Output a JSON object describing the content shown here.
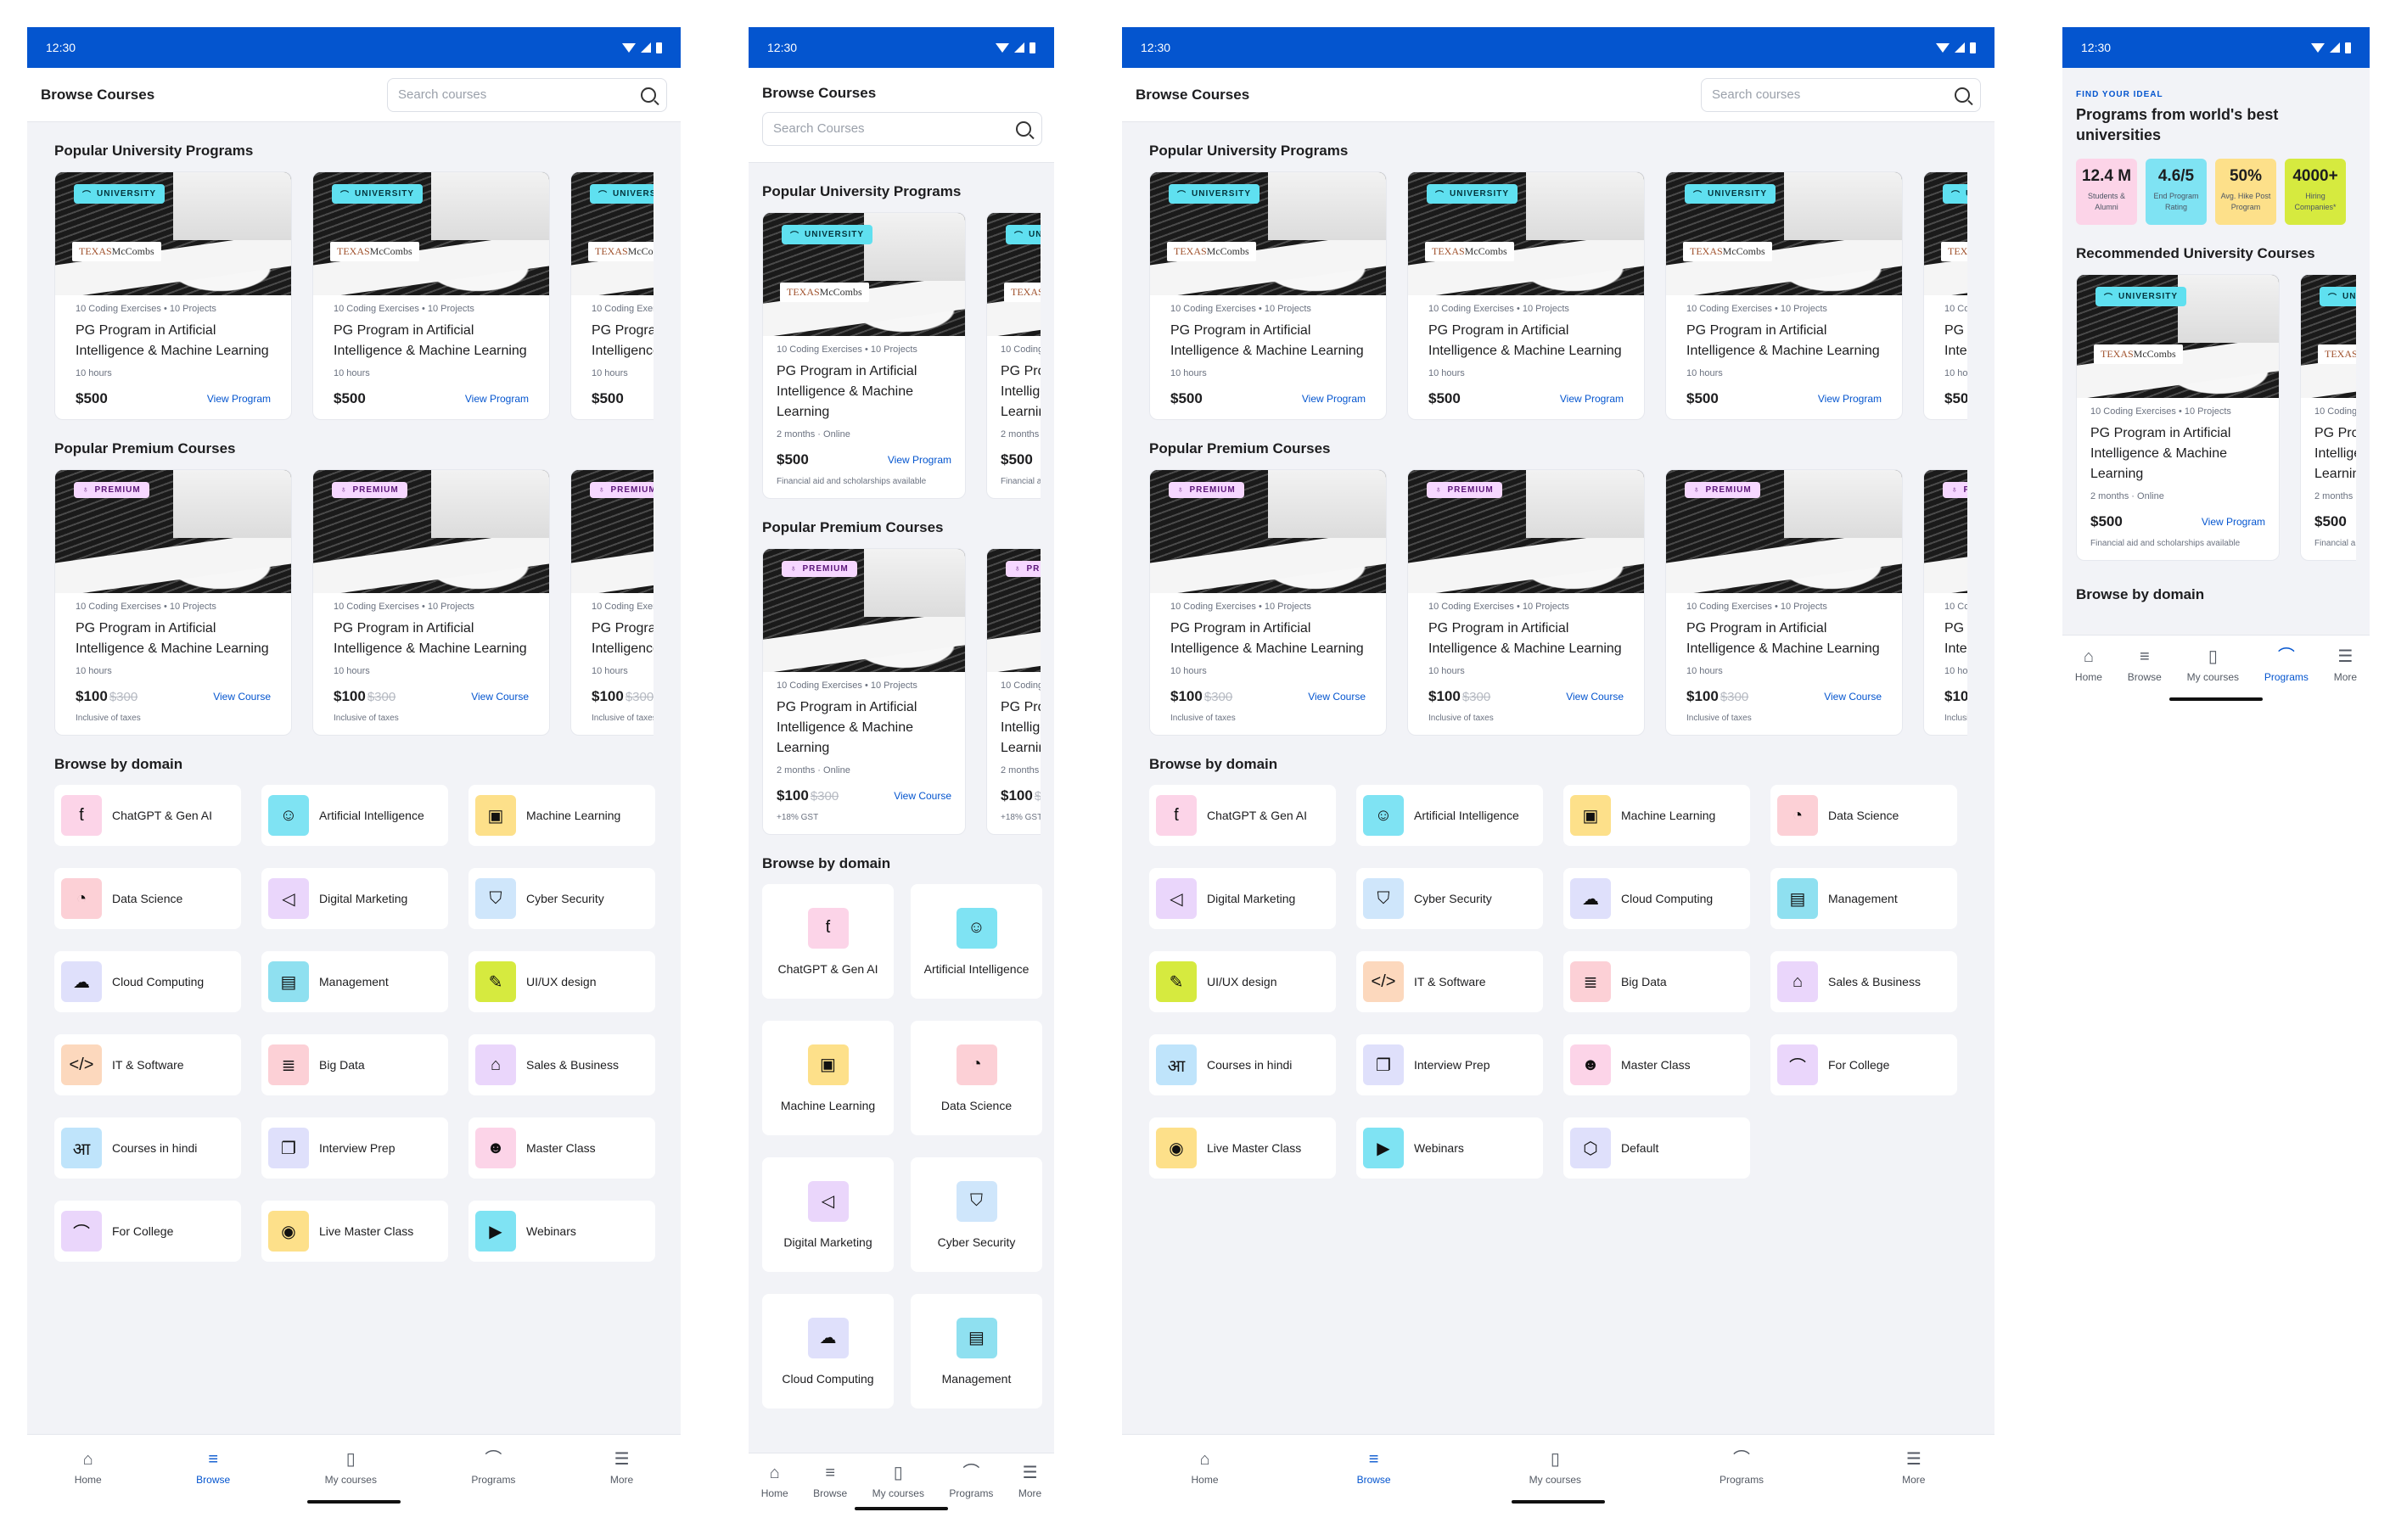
{
  "status_time": "12:30",
  "browse": {
    "title": "Browse Courses",
    "search_placeholder": "Search courses",
    "search_placeholder_small": "Search Courses",
    "popular_university_title": "Popular University Programs",
    "popular_premium_title": "Popular Premium Courses",
    "browse_domain_title": "Browse by domain",
    "university_badge": "UNIVERSITY",
    "premium_badge": "PREMIUM",
    "logo_text": "TEXAS",
    "logo_sub": "McCombs",
    "card_meta": "10 Coding Exercises • 10 Projects",
    "card_title": "PG Program in Artificial Intelligence & Machine Learning",
    "card_duration": "10 hours",
    "card_duration_small": "2 months · Online",
    "university_price": "$500",
    "view_program": "View Program",
    "premium_price": "$100",
    "premium_old_price": "$300",
    "view_course": "View Course",
    "premium_note": "Inclusive of taxes",
    "premium_note_small": "+18% GST",
    "university_note_small": "Financial aid and scholarships available"
  },
  "domains_a": [
    {
      "label": "ChatGPT & Gen AI",
      "icon": "ai-head-icon",
      "glyph": "ƭ",
      "color": "#fcd4e8"
    },
    {
      "label": "Artificial Intelligence",
      "icon": "chatbot-icon",
      "glyph": "☺",
      "color": "#7fe3f3"
    },
    {
      "label": "Machine Learning",
      "icon": "chip-icon",
      "glyph": "▣",
      "color": "#fde08a"
    },
    {
      "label": "Data Science",
      "icon": "data-file-icon",
      "glyph": "◔",
      "color": "#fcd0d6"
    },
    {
      "label": "Digital Marketing",
      "icon": "megaphone-icon",
      "glyph": "◁",
      "color": "#ead6fb"
    },
    {
      "label": "Cyber Security",
      "icon": "shield-icon",
      "glyph": "⛉",
      "color": "#cfe6fb"
    },
    {
      "label": "Cloud Computing",
      "icon": "cloud-icon",
      "glyph": "☁",
      "color": "#dfe0fb"
    },
    {
      "label": "Management",
      "icon": "briefcase-icon",
      "glyph": "▤",
      "color": "#8fe0f0"
    },
    {
      "label": "UI/UX design",
      "icon": "pencil-icon",
      "glyph": "✎",
      "color": "#d6ea3f"
    },
    {
      "label": "IT & Software",
      "icon": "code-icon",
      "glyph": "</>",
      "color": "#fcd8bd"
    },
    {
      "label": "Big Data",
      "icon": "database-icon",
      "glyph": "≣",
      "color": "#fcd0d6"
    },
    {
      "label": "Sales & Business",
      "icon": "tag-icon",
      "glyph": "⌂",
      "color": "#ead6fb"
    },
    {
      "label": "Courses in hindi",
      "icon": "hindi-letter-icon",
      "glyph": "आ",
      "color": "#bfe4fb"
    },
    {
      "label": "Interview Prep",
      "icon": "chat-bubbles-icon",
      "glyph": "❐",
      "color": "#dfe0fb"
    },
    {
      "label": "Master Class",
      "icon": "users-icon",
      "glyph": "☻",
      "color": "#fcd4e8"
    },
    {
      "label": "For College",
      "icon": "graduation-cap-icon",
      "glyph": "⌒",
      "color": "#ead6fb"
    },
    {
      "label": "Live Master Class",
      "icon": "broadcast-icon",
      "glyph": "◉",
      "color": "#fde08a"
    },
    {
      "label": "Webinars",
      "icon": "video-icon",
      "glyph": "▶",
      "color": "#7fe3f3"
    }
  ],
  "domains_small": [
    {
      "label": "ChatGPT & Gen AI",
      "icon": "ai-head-icon",
      "glyph": "ƭ",
      "color": "#fcd4e8"
    },
    {
      "label": "Artificial Intelligence",
      "icon": "chatbot-icon",
      "glyph": "☺",
      "color": "#7fe3f3"
    },
    {
      "label": "Machine Learning",
      "icon": "chip-icon",
      "glyph": "▣",
      "color": "#fde08a"
    },
    {
      "label": "Data Science",
      "icon": "data-file-icon",
      "glyph": "◔",
      "color": "#fcd0d6"
    },
    {
      "label": "Digital Marketing",
      "icon": "megaphone-icon",
      "glyph": "◁",
      "color": "#ead6fb"
    },
    {
      "label": "Cyber Security",
      "icon": "shield-icon",
      "glyph": "⛉",
      "color": "#cfe6fb"
    },
    {
      "label": "Cloud Computing",
      "icon": "cloud-icon",
      "glyph": "☁",
      "color": "#dfe0fb"
    },
    {
      "label": "Management",
      "icon": "briefcase-icon",
      "glyph": "▤",
      "color": "#8fe0f0"
    }
  ],
  "domains_c": [
    {
      "label": "ChatGPT & Gen AI",
      "icon": "ai-head-icon",
      "glyph": "ƭ",
      "color": "#fcd4e8"
    },
    {
      "label": "Artificial Intelligence",
      "icon": "chatbot-icon",
      "glyph": "☺",
      "color": "#7fe3f3"
    },
    {
      "label": "Machine Learning",
      "icon": "chip-icon",
      "glyph": "▣",
      "color": "#fde08a"
    },
    {
      "label": "Data Science",
      "icon": "data-file-icon",
      "glyph": "◔",
      "color": "#fcd0d6"
    },
    {
      "label": "Digital Marketing",
      "icon": "megaphone-icon",
      "glyph": "◁",
      "color": "#ead6fb"
    },
    {
      "label": "Cyber Security",
      "icon": "shield-icon",
      "glyph": "⛉",
      "color": "#cfe6fb"
    },
    {
      "label": "Cloud Computing",
      "icon": "cloud-icon",
      "glyph": "☁",
      "color": "#dfe0fb"
    },
    {
      "label": "Management",
      "icon": "briefcase-icon",
      "glyph": "▤",
      "color": "#8fe0f0"
    },
    {
      "label": "UI/UX design",
      "icon": "pencil-icon",
      "glyph": "✎",
      "color": "#d6ea3f"
    },
    {
      "label": "IT & Software",
      "icon": "code-icon",
      "glyph": "</>",
      "color": "#fcd8bd"
    },
    {
      "label": "Big Data",
      "icon": "database-icon",
      "glyph": "≣",
      "color": "#fcd0d6"
    },
    {
      "label": "Sales & Business",
      "icon": "tag-icon",
      "glyph": "⌂",
      "color": "#ead6fb"
    },
    {
      "label": "Courses in hindi",
      "icon": "hindi-letter-icon",
      "glyph": "आ",
      "color": "#bfe4fb"
    },
    {
      "label": "Interview Prep",
      "icon": "chat-bubbles-icon",
      "glyph": "❐",
      "color": "#dfe0fb"
    },
    {
      "label": "Master Class",
      "icon": "users-icon",
      "glyph": "☻",
      "color": "#fcd4e8"
    },
    {
      "label": "For College",
      "icon": "graduation-cap-icon",
      "glyph": "⌒",
      "color": "#ead6fb"
    },
    {
      "label": "Live Master Class",
      "icon": "broadcast-icon",
      "glyph": "◉",
      "color": "#fde08a"
    },
    {
      "label": "Webinars",
      "icon": "video-icon",
      "glyph": "▶",
      "color": "#7fe3f3"
    },
    {
      "label": "Default",
      "icon": "default-cube-icon",
      "glyph": "⬡",
      "color": "#dfe0fb"
    }
  ],
  "nav": [
    {
      "label": "Home",
      "icon": "home-icon",
      "glyph": "⌂"
    },
    {
      "label": "Browse",
      "icon": "browse-icon",
      "glyph": "≡"
    },
    {
      "label": "My courses",
      "icon": "book-icon",
      "glyph": "▯"
    },
    {
      "label": "Programs",
      "icon": "graduation-cap-icon",
      "glyph": "⌒"
    },
    {
      "label": "More",
      "icon": "menu-icon",
      "glyph": "☰"
    }
  ],
  "programs": {
    "kicker": "FIND YOUR IDEAL",
    "title": "Programs from world's best universities",
    "stats": [
      {
        "value": "12.4 M",
        "label": "Students & Alumni",
        "color": "#fcd4e8"
      },
      {
        "value": "4.6/5",
        "label": "End Program Rating",
        "color": "#7fe3f3"
      },
      {
        "value": "50%",
        "label": "Avg. Hike Post Program",
        "color": "#fde08a"
      },
      {
        "value": "4000+",
        "label": "Hiring Companies*",
        "color": "#d6ea3f"
      }
    ],
    "recommended_title": "Recommended University Courses",
    "browse_domain_title": "Browse by domain"
  }
}
